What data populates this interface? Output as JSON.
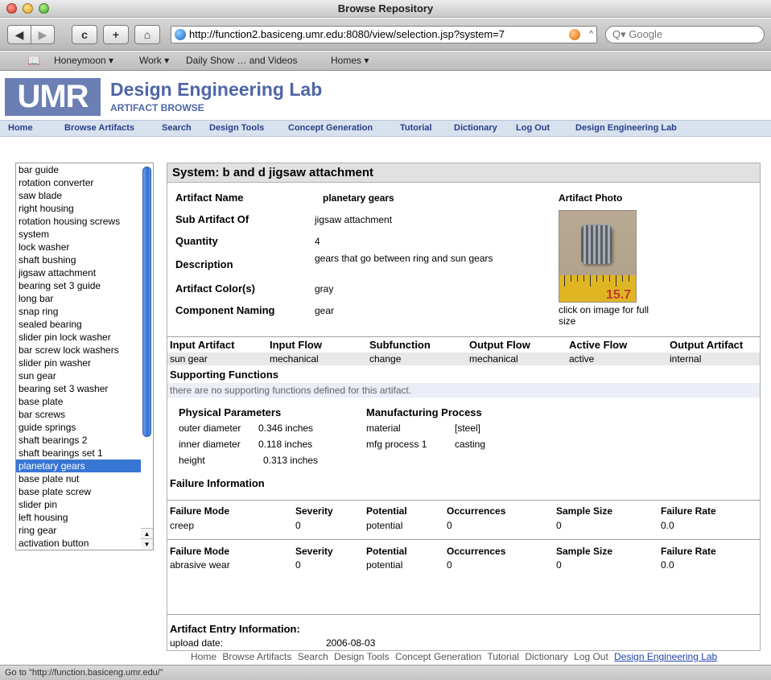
{
  "window": {
    "title": "Browse Repository"
  },
  "browser": {
    "back": "◀",
    "forward": "▶",
    "reload": "c",
    "add": "+",
    "home": "⌂",
    "url": "http://function2.basiceng.umr.edu:8080/view/selection.jsp?system=7",
    "search_placeholder": "Q▾ Google",
    "bookmarks": [
      "Honeymoon ▾",
      "Work ▾",
      "Daily Show … and Videos",
      "Homes ▾"
    ]
  },
  "site": {
    "logo": "UMR",
    "title": "Design Engineering Lab",
    "subtitle": "ARTIFACT BROWSE",
    "nav": [
      "Home",
      "Browse Artifacts",
      "Search",
      "Design Tools",
      "Concept Generation",
      "Tutorial",
      "Dictionary",
      "Log Out",
      "Design Engineering Lab"
    ]
  },
  "artifact_list": [
    "bar guide",
    "rotation converter",
    "saw blade",
    "right housing",
    "rotation housing screws",
    "system",
    "lock washer",
    "shaft bushing",
    "jigsaw attachment",
    "bearing set 3 guide",
    "long bar",
    "snap ring",
    "sealed bearing",
    "slider pin lock washer",
    "bar screw lock washers",
    "slider pin washer",
    "sun gear",
    "bearing set 3 washer",
    "base plate",
    "bar screws",
    "guide springs",
    "shaft bearings 2",
    "shaft bearings set 1",
    "planetary gears",
    "base plate nut",
    "base plate screw",
    "slider pin",
    "left housing",
    "ring gear",
    "activation button"
  ],
  "selected_artifact": "planetary gears",
  "system": {
    "heading": "System: b and d jigsaw attachment"
  },
  "properties": [
    {
      "label": "Artifact Name",
      "value": "planetary gears"
    },
    {
      "label": "Sub Artifact Of",
      "value": "jigsaw attachment"
    },
    {
      "label": "Quantity",
      "value": "4"
    },
    {
      "label": "Description",
      "value": "gears that go between ring and sun gears"
    },
    {
      "label": "Artifact Color(s)",
      "value": "gray"
    },
    {
      "label": "Component Naming",
      "value": "gear"
    }
  ],
  "photo": {
    "heading": "Artifact Photo",
    "caption": "click on image for full size",
    "ruler_mark": "15.7"
  },
  "flow": {
    "headers": [
      "Input Artifact",
      "Input Flow",
      "Subfunction",
      "Output Flow",
      "Active Flow",
      "Output Artifact"
    ],
    "row": [
      "sun gear",
      "mechanical",
      "change",
      "mechanical",
      "active",
      "internal"
    ]
  },
  "supporting": {
    "heading": "Supporting Functions",
    "message": "there are no supporting functions defined for this artifact."
  },
  "physical": {
    "heading": "Physical Parameters",
    "rows": [
      {
        "name": "outer diameter",
        "value": "0.346 inches"
      },
      {
        "name": "inner diameter",
        "value": "0.118 inches"
      },
      {
        "name": "height",
        "value": "0.313 inches"
      }
    ]
  },
  "manufacturing": {
    "heading": "Manufacturing Process",
    "rows": [
      {
        "name": "material",
        "value": "[steel]"
      },
      {
        "name": "mfg process 1",
        "value": "casting"
      }
    ]
  },
  "failure": {
    "heading": "Failure Information",
    "headers": [
      "Failure Mode",
      "Severity",
      "Potential",
      "Occurrences",
      "Sample Size",
      "Failure Rate"
    ],
    "rows": [
      [
        "creep",
        "0",
        "potential",
        "0",
        "0",
        "0.0"
      ],
      [
        "abrasive wear",
        "0",
        "potential",
        "0",
        "0",
        "0.0"
      ]
    ]
  },
  "entry": {
    "heading": "Artifact Entry Information:",
    "label": "upload date:",
    "date": "2006-08-03"
  },
  "footer_links": [
    "Home",
    "Browse Artifacts",
    "Search",
    "Design Tools",
    "Concept Generation",
    "Tutorial",
    "Dictionary",
    "Log Out",
    "Design Engineering Lab"
  ],
  "status": "Go to \"http://function.basiceng.umr.edu/\""
}
